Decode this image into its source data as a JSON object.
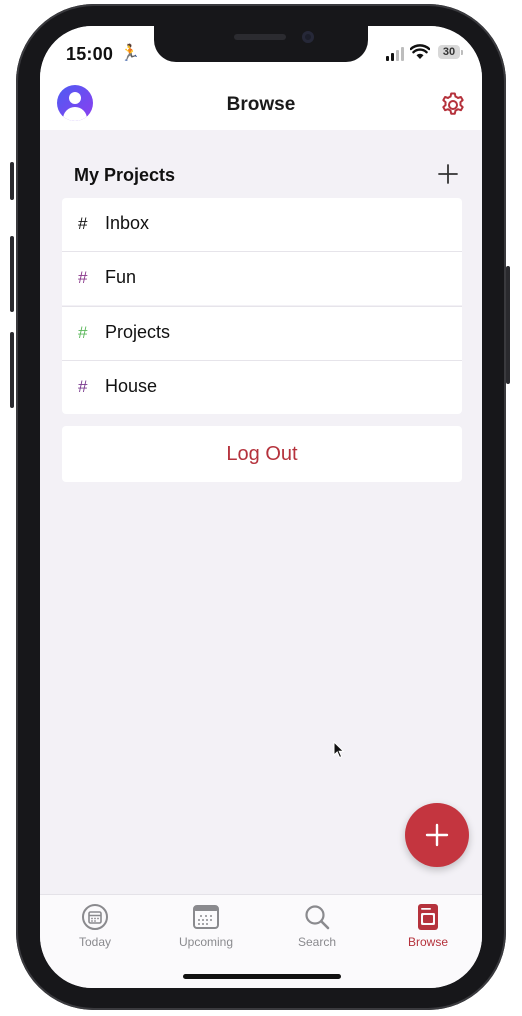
{
  "status_bar": {
    "time": "15:00",
    "battery": "30"
  },
  "header": {
    "title": "Browse"
  },
  "projects": {
    "section_title": "My Projects",
    "items": [
      {
        "label": "Inbox",
        "hash": "#",
        "color": "#111111"
      },
      {
        "label": "Fun",
        "hash": "#",
        "color": "#8b3a8c"
      },
      {
        "label": "Projects",
        "hash": "#",
        "color": "#5cb85c"
      },
      {
        "label": "House",
        "hash": "#",
        "color": "#7b3b8f"
      }
    ]
  },
  "logout": {
    "label": "Log Out"
  },
  "tabs": [
    {
      "label": "Today",
      "icon": "calendar-day-icon"
    },
    {
      "label": "Upcoming",
      "icon": "calendar-grid-icon"
    },
    {
      "label": "Search",
      "icon": "search-icon"
    },
    {
      "label": "Browse",
      "icon": "browse-icon",
      "active": true
    }
  ],
  "colors": {
    "accent": "#c4353f",
    "avatar_gradient": [
      "#4d5cf2",
      "#8d3ef0"
    ]
  }
}
